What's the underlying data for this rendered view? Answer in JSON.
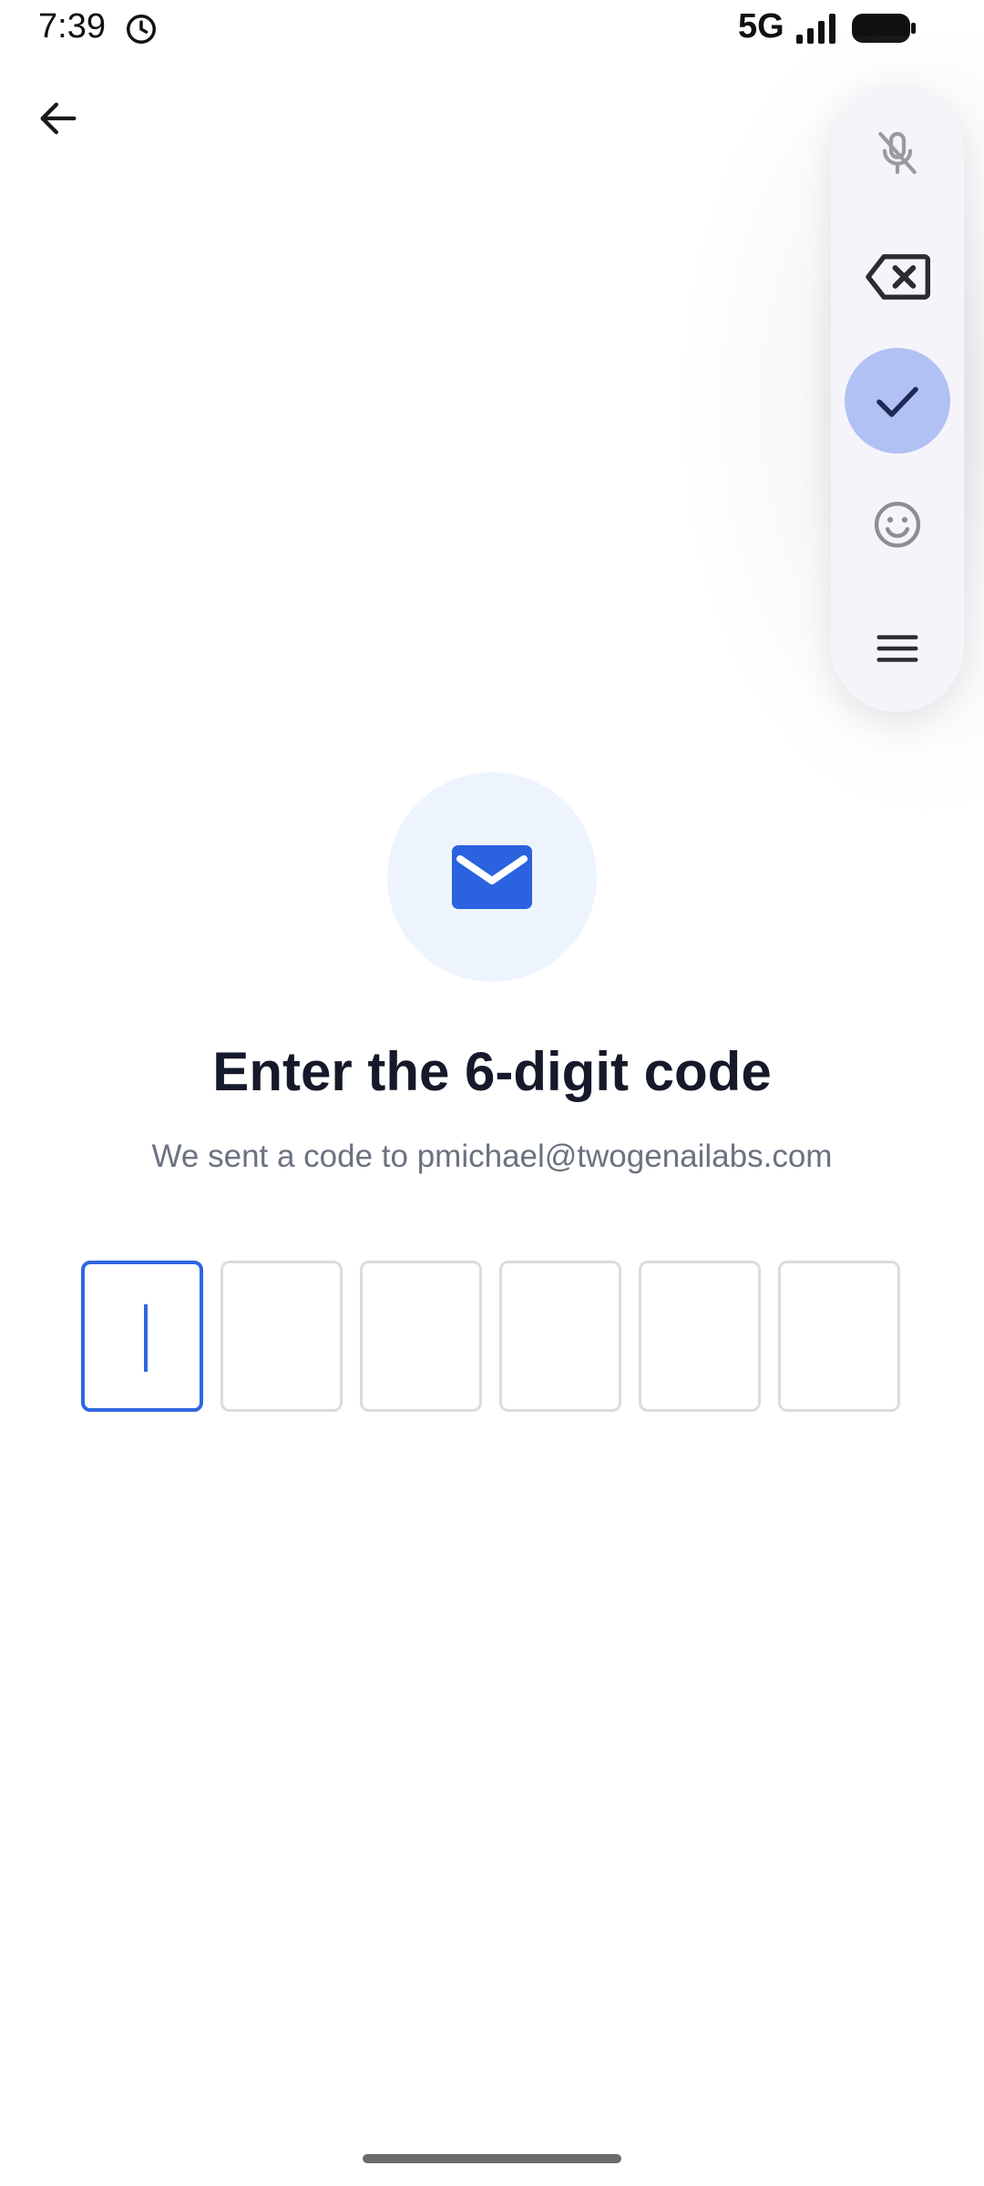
{
  "status_bar": {
    "time": "7:39",
    "network": "5G",
    "alarm_icon": "alarm-clock-icon",
    "signal_icon": "cell-signal-icon",
    "battery_icon": "battery-icon"
  },
  "nav": {
    "back_icon": "arrow-left-icon"
  },
  "keyboard_toolbar": {
    "items": [
      {
        "icon": "mic-off-icon",
        "active": false
      },
      {
        "icon": "backspace-icon",
        "active": false
      },
      {
        "icon": "check-icon",
        "active": true
      },
      {
        "icon": "emoji-icon",
        "active": false
      },
      {
        "icon": "menu-icon",
        "active": false
      }
    ],
    "colors": {
      "background": "#f6f4fb",
      "active": "#b1c1f4"
    }
  },
  "verification": {
    "icon": "mail-icon",
    "title": "Enter the 6-digit code",
    "subtitle": "We sent a code to pmichael@twogenailabs.com",
    "code_length": 6,
    "code_values": [
      "",
      "",
      "",
      "",
      "",
      ""
    ],
    "focused_index": 0
  },
  "colors": {
    "accent": "#2f66e0",
    "icon_circle": "#eef4fe",
    "title": "#15192a",
    "subtitle": "#6b7280"
  }
}
